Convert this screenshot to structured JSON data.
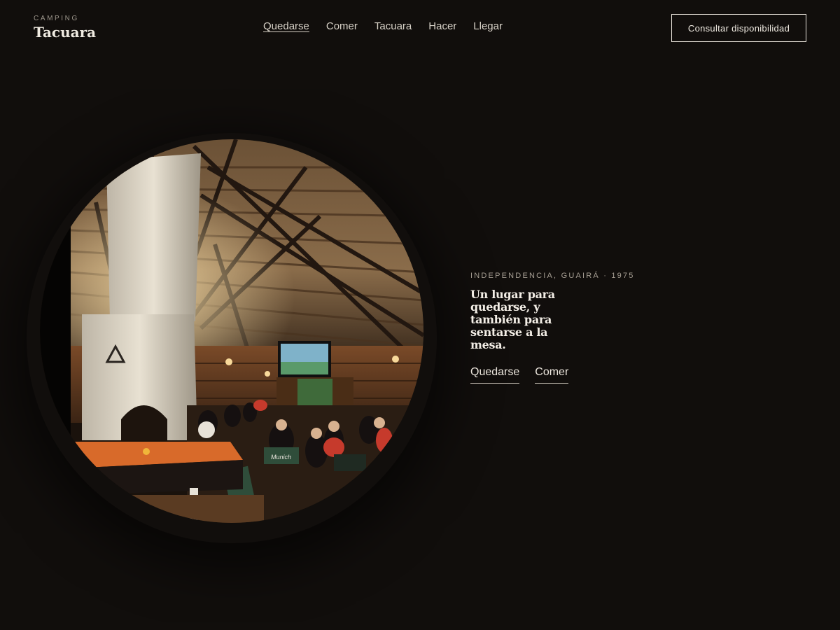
{
  "brand": {
    "eyebrow": "CAMPING",
    "name": "Tacuara"
  },
  "nav": {
    "items": [
      {
        "label": "Quedarse",
        "active": true
      },
      {
        "label": "Comer",
        "active": false
      },
      {
        "label": "Tacuara",
        "active": false
      },
      {
        "label": "Hacer",
        "active": false
      },
      {
        "label": "Llegar",
        "active": false
      }
    ]
  },
  "header": {
    "cta_label": "Consultar disponibilidad"
  },
  "hero": {
    "eyebrow": "INDEPENDENCIA, GUAIRÁ · 1975",
    "headline": "Un lugar para quedarse, y también para sentarse a la mesa.",
    "links": [
      {
        "label": "Quedarse"
      },
      {
        "label": "Comer"
      }
    ],
    "photo_signage": "Munich"
  },
  "colors": {
    "background": "#110e0c",
    "text": "#e9e4dc",
    "muted": "#a79f94",
    "pool_felt": "#d86a2a"
  }
}
